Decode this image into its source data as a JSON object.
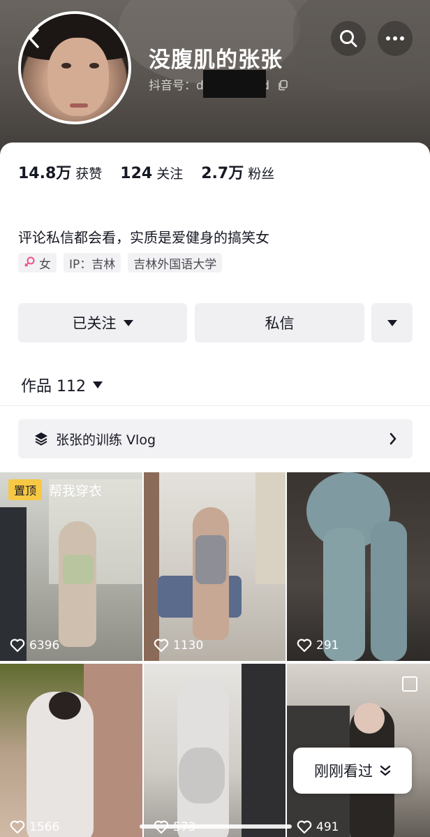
{
  "profile": {
    "nickname": "没腹肌的张张",
    "douyin_id_label": "抖音号：dybshi3tfjxd",
    "bio": "评论私信都会看，实质是爱健身的搞笑女"
  },
  "stats": [
    {
      "value": "14.8万",
      "label": "获赞"
    },
    {
      "value": "124",
      "label": "关注"
    },
    {
      "value": "2.7万",
      "label": "粉丝"
    }
  ],
  "tags": {
    "gender": "女",
    "ip": "IP：吉林",
    "school": "吉林外国语大学",
    "gender_color": "#f0508a"
  },
  "actions": {
    "follow_label": "已关注",
    "message_label": "私信"
  },
  "works": {
    "tab_label": "作品 112"
  },
  "collection": {
    "label": "张张的训练 Vlog"
  },
  "videos": [
    {
      "likes": "6396",
      "pinned_label": "置顶",
      "caption": "帮我穿衣"
    },
    {
      "likes": "1130"
    },
    {
      "likes": "291"
    },
    {
      "likes": "1566"
    },
    {
      "likes": "573"
    },
    {
      "likes": "491"
    }
  ],
  "recent": {
    "label": "刚刚看过"
  },
  "colors": {
    "pin_badge": "#f7c844",
    "button_bg": "#f0f0f2",
    "text": "#161823"
  }
}
